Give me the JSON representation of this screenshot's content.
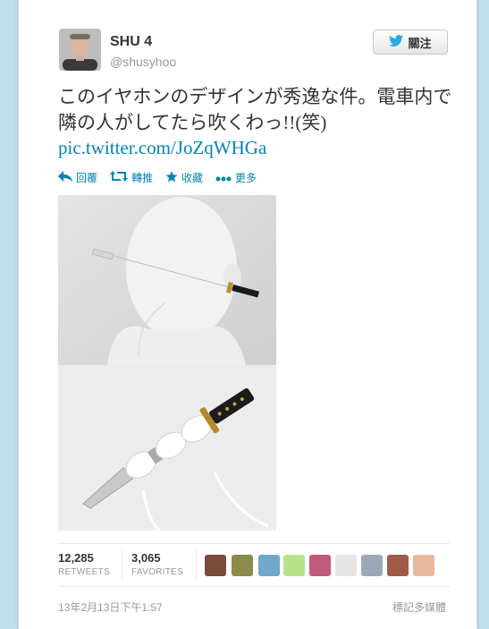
{
  "tweet": {
    "name": "SHU 4",
    "handle": "@shusyhoo",
    "follow_label": "關注",
    "text": "このイヤホンのデザインが秀逸な件。電車内で隣の人がしてたら吹くわっ!!(笑)",
    "link": "pic.twitter.com/JoZqWHGa",
    "actions": {
      "reply": "回覆",
      "retweet": "轉推",
      "favorite": "收藏",
      "more": "更多"
    },
    "stats": {
      "retweets_count": "12,285",
      "retweets_label": "RETWEETS",
      "favorites_count": "3,065",
      "favorites_label": "FAVORITES"
    },
    "timestamp": "13年2月13日下午1:57",
    "flag_media": "標記多媒體"
  },
  "colors": {
    "background": "#c0deed",
    "link": "#0084b4",
    "twitter_blue": "#2ba9e1"
  },
  "icons": [
    "twitter-bird-icon",
    "reply-icon",
    "retweet-icon",
    "favorite-star-icon",
    "more-dots-icon"
  ]
}
